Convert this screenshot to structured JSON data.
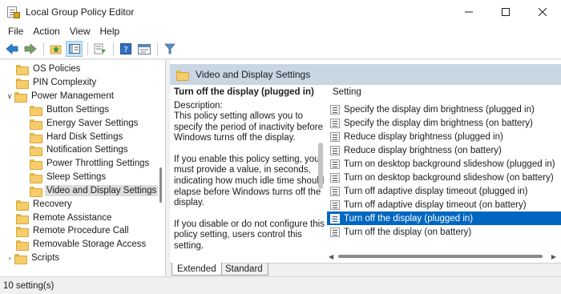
{
  "window": {
    "title": "Local Group Policy Editor"
  },
  "menu": [
    "File",
    "Action",
    "View",
    "Help"
  ],
  "tree": {
    "items": [
      {
        "label": "OS Policies",
        "level": 1,
        "expanded": null,
        "selected": false
      },
      {
        "label": "PIN Complexity",
        "level": 1,
        "expanded": null,
        "selected": false
      },
      {
        "label": "Power Management",
        "level": 1,
        "expanded": true,
        "selected": false
      },
      {
        "label": "Button Settings",
        "level": 2,
        "expanded": null,
        "selected": false
      },
      {
        "label": "Energy Saver Settings",
        "level": 2,
        "expanded": null,
        "selected": false
      },
      {
        "label": "Hard Disk Settings",
        "level": 2,
        "expanded": null,
        "selected": false
      },
      {
        "label": "Notification Settings",
        "level": 2,
        "expanded": null,
        "selected": false
      },
      {
        "label": "Power Throttling Settings",
        "level": 2,
        "expanded": null,
        "selected": false
      },
      {
        "label": "Sleep Settings",
        "level": 2,
        "expanded": null,
        "selected": false
      },
      {
        "label": "Video and Display Settings",
        "level": 2,
        "expanded": null,
        "selected": true
      },
      {
        "label": "Recovery",
        "level": 1,
        "expanded": null,
        "selected": false
      },
      {
        "label": "Remote Assistance",
        "level": 1,
        "expanded": null,
        "selected": false
      },
      {
        "label": "Remote Procedure Call",
        "level": 1,
        "expanded": null,
        "selected": false
      },
      {
        "label": "Removable Storage Access",
        "level": 1,
        "expanded": null,
        "selected": false
      },
      {
        "label": "Scripts",
        "level": 1,
        "expanded": false,
        "selected": false
      }
    ]
  },
  "right_pane": {
    "header": "Video and Display Settings",
    "description": {
      "title": "Turn off the display (plugged in)",
      "label": "Description:",
      "paragraphs": [
        "This policy setting allows you to specify the period of inactivity before Windows turns off the display.",
        "If you enable this policy setting, you must provide a value, in seconds, indicating how much idle time should elapse before Windows turns off the display.",
        "If you disable or do not configure this policy setting, users control this setting."
      ]
    },
    "list": {
      "column_header": "Setting",
      "rows": [
        {
          "label": "Specify the display dim brightness (plugged in)",
          "selected": false
        },
        {
          "label": "Specify the display dim brightness (on battery)",
          "selected": false
        },
        {
          "label": "Reduce display brightness (plugged in)",
          "selected": false
        },
        {
          "label": "Reduce display brightness (on battery)",
          "selected": false
        },
        {
          "label": "Turn on desktop background slideshow (plugged in)",
          "selected": false
        },
        {
          "label": "Turn on desktop background slideshow (on battery)",
          "selected": false
        },
        {
          "label": "Turn off adaptive display timeout (plugged in)",
          "selected": false
        },
        {
          "label": "Turn off adaptive display timeout (on battery)",
          "selected": false
        },
        {
          "label": "Turn off the display (plugged in)",
          "selected": true
        },
        {
          "label": "Turn off the display (on battery)",
          "selected": false
        }
      ]
    },
    "tabs": [
      "Extended",
      "Standard"
    ]
  },
  "status": {
    "text": "10 setting(s)"
  },
  "colors": {
    "selection": "#0067c0",
    "pane_header": "#c9d6e4",
    "folder": "#f5cd6a"
  }
}
